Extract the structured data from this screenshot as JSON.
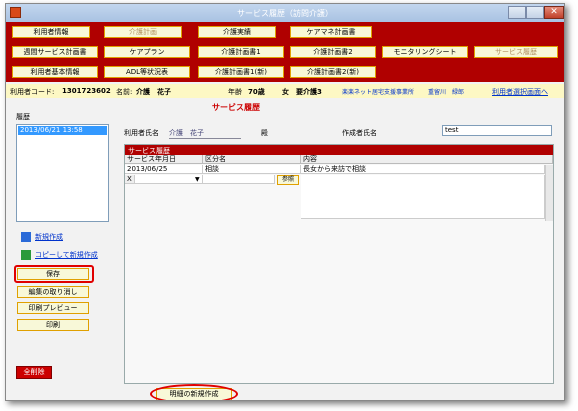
{
  "window": {
    "title": "サービス履歴（訪問介護）"
  },
  "nav_row1": [
    "利用者情報",
    "介護計画",
    "介護実績",
    "ケアマネ計画書"
  ],
  "nav_row2": [
    "週間サービス計画書",
    "ケアプラン",
    "介護計画書1",
    "介護計画書2",
    "モニタリングシート",
    "サービス履歴"
  ],
  "nav_row3": [
    "利用者基本情報",
    "ADL等状況表",
    "介護計画書1(新)",
    "介護計画書2(新)"
  ],
  "info": {
    "code_label": "利用者コード:",
    "code_value": "1301723602",
    "name_label": "名前:",
    "name_value": "介護　花子",
    "age_label": "年齢",
    "age_value": "70歳",
    "gender": "女",
    "care_level": "要介護3",
    "office": "楽楽ネット居宅支援事業所",
    "manager": "重留川　緑郎",
    "select_link": "利用者選択画面へ"
  },
  "page_heading": "サービス履歴",
  "history": {
    "label": "履歴",
    "items": [
      "2013/06/21 13:58"
    ]
  },
  "form": {
    "user_name_label": "利用者氏名",
    "user_name_value": "介護　花子",
    "honorific": "殿",
    "author_label": "作成者氏名",
    "author_value": "test"
  },
  "grid": {
    "title": "サービス履歴",
    "columns": [
      "サービス年月日",
      "区分名",
      "内容"
    ],
    "rows": [
      {
        "date": "2013/06/25",
        "category": "相談",
        "content": "長女から来訪で相談"
      }
    ],
    "new_row": {
      "marker": "X",
      "ref_button": "参照"
    }
  },
  "sidebar": {
    "new_create": "新規作成",
    "copy_create": "コピーして新規作成",
    "save": "保存",
    "cancel_edit": "編集の取り消し",
    "print_preview": "印刷プレビュー",
    "print": "印刷",
    "delete_all": "全削除"
  },
  "bottom": {
    "new_detail": "明細の新規作成"
  },
  "colors": {
    "brand_red": "#b00000",
    "button_fill": "#f8f8d8",
    "info_strip": "#fdf8c4",
    "highlight_ring": "#e00000"
  }
}
